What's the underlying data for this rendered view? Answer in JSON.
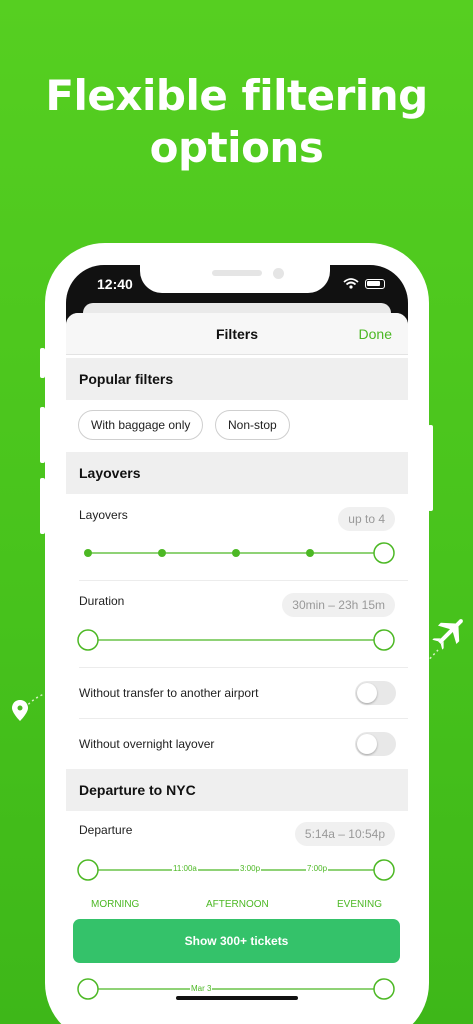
{
  "headline": {
    "line1": "Flexible filtering",
    "line2": "options"
  },
  "status": {
    "time": "12:40"
  },
  "nav": {
    "title": "Filters",
    "done": "Done"
  },
  "popular": {
    "title": "Popular filters",
    "chips": [
      "With baggage only",
      "Non-stop"
    ]
  },
  "layovers_section": {
    "title": "Layovers"
  },
  "layovers": {
    "label": "Layovers",
    "value": "up to 4",
    "steps": 5,
    "selected_max": 4
  },
  "duration": {
    "label": "Duration",
    "value": "30min – 23h 15m"
  },
  "toggles": [
    {
      "label": "Without transfer to another airport",
      "on": false
    },
    {
      "label": "Without overnight layover",
      "on": false
    }
  ],
  "departure_section": {
    "title": "Departure to NYC"
  },
  "departure": {
    "label": "Departure",
    "value": "5:14a – 10:54p",
    "ticks": [
      "11:00a",
      "3:00p",
      "7:00p"
    ],
    "times_of_day": [
      "MORNING",
      "AFTERNOON",
      "EVENING"
    ]
  },
  "cta": {
    "label": "Show 300+ tickets"
  },
  "date_slider": {
    "tick": "Mar 3"
  },
  "colors": {
    "background": "#52cc20",
    "accent": "#4cb824",
    "cta": "#34c26a"
  }
}
